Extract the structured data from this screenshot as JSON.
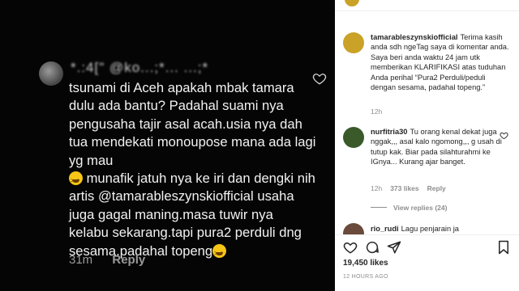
{
  "post_image": {
    "comment_username": "*.:4[\" @ko...;*... ...;*",
    "comment_text": "tsunami di Aceh apakah mbak tamara dulu ada bantu? Padahal suami nya pengusaha tajir asal acah.usia nya dah tua mendekati monoupose mana ada lagi yg mau",
    "comment_text_2": " munafik jatuh nya ke iri dan dengki nih artis @tamarableszynskiofficial usaha juga gagal maning.masa tuwir nya kelabu sekarang.tapi pura2 perduli dng sesama.padahal topeng",
    "comment_time": "31m",
    "reply_label": "Reply",
    "emoji_icon": "grinning-squinting-face"
  },
  "caption": {
    "username": "tamarableszynskiofficial",
    "text": "Terima kasih anda sdh ngeTag saya di komentar anda. Saya beri anda waktu 24 jam utk memberikan KLARIFIKASI atas tuduhan Anda perihal “Pura2 Perduli/peduli dengan sesama, padahal topeng.”",
    "time": "12h"
  },
  "comments": [
    {
      "username": "nurfitria30",
      "text": "Tu orang kenal dekat juga nggak,,, asal kalo ngomong,,, g usah di tutup kak. Biar pada silahturahmi ke IGnya... Kurang ajar banget.",
      "time": "12h",
      "likes": "373 likes",
      "reply": "Reply",
      "view_replies": "View replies (24)"
    },
    {
      "username": "rio_rudi",
      "text": "Lagu penjarain ja"
    }
  ],
  "footer": {
    "likes": "19,450 likes",
    "timeago": "12 HOURS AGO"
  },
  "colors": {
    "avatar_gold": "#c9a227",
    "avatar_green": "#3a5a2a",
    "text": "#262626",
    "muted": "#8e8e8e"
  }
}
